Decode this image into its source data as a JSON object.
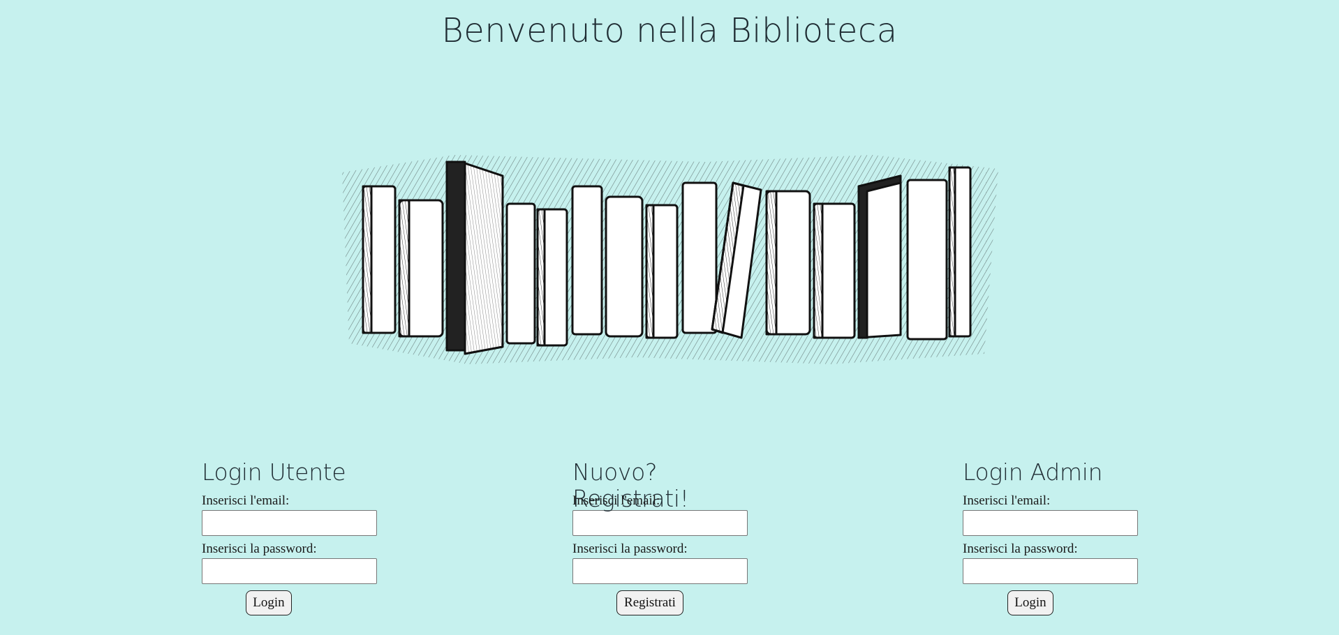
{
  "page": {
    "title": "Benvenuto nella Biblioteca",
    "background": "#c6f1ee"
  },
  "illustration": {
    "icon": "books-row-illustration"
  },
  "login_user": {
    "heading": "Login Utente",
    "email_label": "Inserisci l'email:",
    "email_value": "",
    "password_label": "Inserisci la password:",
    "password_value": "",
    "button_label": "Login"
  },
  "register": {
    "heading": "Nuovo? Registrati!",
    "email_label": "Inserisci l'email:",
    "email_value": "",
    "password_label": "Inserisci la password:",
    "password_value": "",
    "button_label": "Registrati"
  },
  "login_admin": {
    "heading": "Login Admin",
    "email_label": "Inserisci l'email:",
    "email_value": "",
    "password_label": "Inserisci la password:",
    "password_value": "",
    "button_label": "Login"
  }
}
